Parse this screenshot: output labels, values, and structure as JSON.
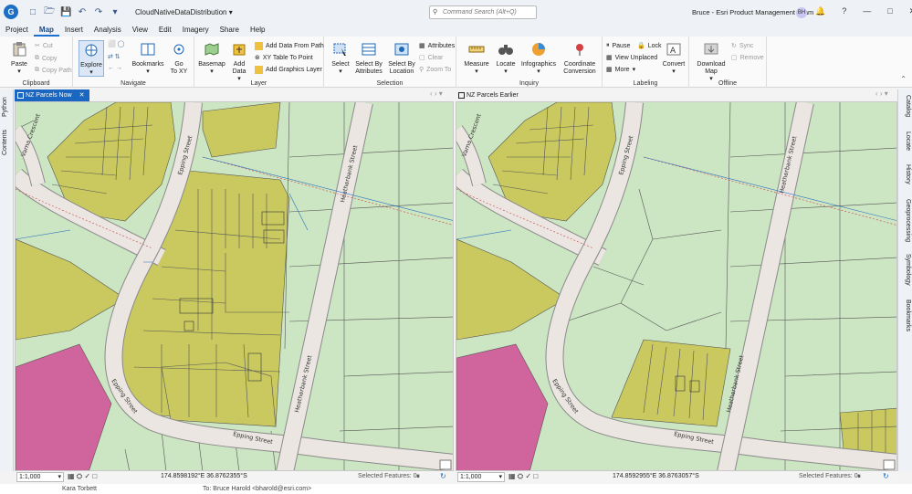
{
  "app": {
    "logo": "G",
    "doc_title": "CloudNativeDataDistribution",
    "command_search_placeholder": "Command Search (Alt+Q)",
    "user_name": "Bruce - Esri Product Management Team",
    "user_initials": "BH"
  },
  "menu_tabs": [
    "Project",
    "Map",
    "Insert",
    "Analysis",
    "View",
    "Edit",
    "Imagery",
    "Share",
    "Help"
  ],
  "active_tab": "Map",
  "ribbon": {
    "clipboard": {
      "label": "Clipboard",
      "paste": "Paste",
      "cut": "Cut",
      "copy": "Copy",
      "copy_path": "Copy Path"
    },
    "navigate": {
      "label": "Navigate",
      "explore": "Explore",
      "bookmarks": "Bookmarks",
      "go_to": "Go",
      "go_to2": "To XY"
    },
    "layer": {
      "label": "Layer",
      "basemap": "Basemap",
      "add": "Add",
      "data": "Data",
      "add_from_path": "Add Data From Path",
      "xy_table": "XY Table To Point",
      "add_graphics": "Add Graphics Layer"
    },
    "selection": {
      "label": "Selection",
      "select": "Select",
      "select_by_attr": "Select By",
      "select_by_attr2": "Attributes",
      "select_by_loc": "Select By",
      "select_by_loc2": "Location",
      "attributes": "Attributes",
      "clear": "Clear",
      "zoom_to": "Zoom To"
    },
    "inquiry": {
      "label": "Inquiry",
      "measure": "Measure",
      "locate": "Locate",
      "infographics": "Infographics",
      "coord_conv": "Coordinate",
      "coord_conv2": "Conversion"
    },
    "labeling": {
      "label": "Labeling",
      "pause": "Pause",
      "lock": "Lock",
      "view_unplaced": "View Unplaced",
      "more": "More",
      "convert": "Convert"
    },
    "offline": {
      "label": "Offline",
      "download": "Download",
      "download2": "Map",
      "sync": "Sync",
      "remove": "Remove"
    }
  },
  "left_panes": [
    "Python",
    "Contents"
  ],
  "right_panes": [
    "Catalog",
    "Locate",
    "History",
    "Geoprocessing",
    "Symbology",
    "Bookmarks"
  ],
  "views": [
    {
      "tab": "NZ Parcels Now",
      "scale": "1:1,000",
      "coords": "174.8598192°E 36.8762355°S",
      "selected": "Selected Features: 0"
    },
    {
      "tab": "NZ Parcels Earlier",
      "scale": "1:1,000",
      "coords": "174.8592955°E 36.8763057°S",
      "selected": "Selected Features: 0"
    }
  ],
  "street_labels": {
    "varna": "Varna Crescent",
    "epping": "Epping Street",
    "heatherbank": "Heatherbank Street"
  },
  "colors": {
    "parcel_green": "#cce5c2",
    "parcel_olive": "#c9c960",
    "parcel_magenta": "#d0649c",
    "road": "#ebe6e1",
    "accent": "#1967c0"
  },
  "bottom_text": {
    "left": "Kara Torbett",
    "mid": "To: Bruce Harold <bharold@esri.com>"
  }
}
